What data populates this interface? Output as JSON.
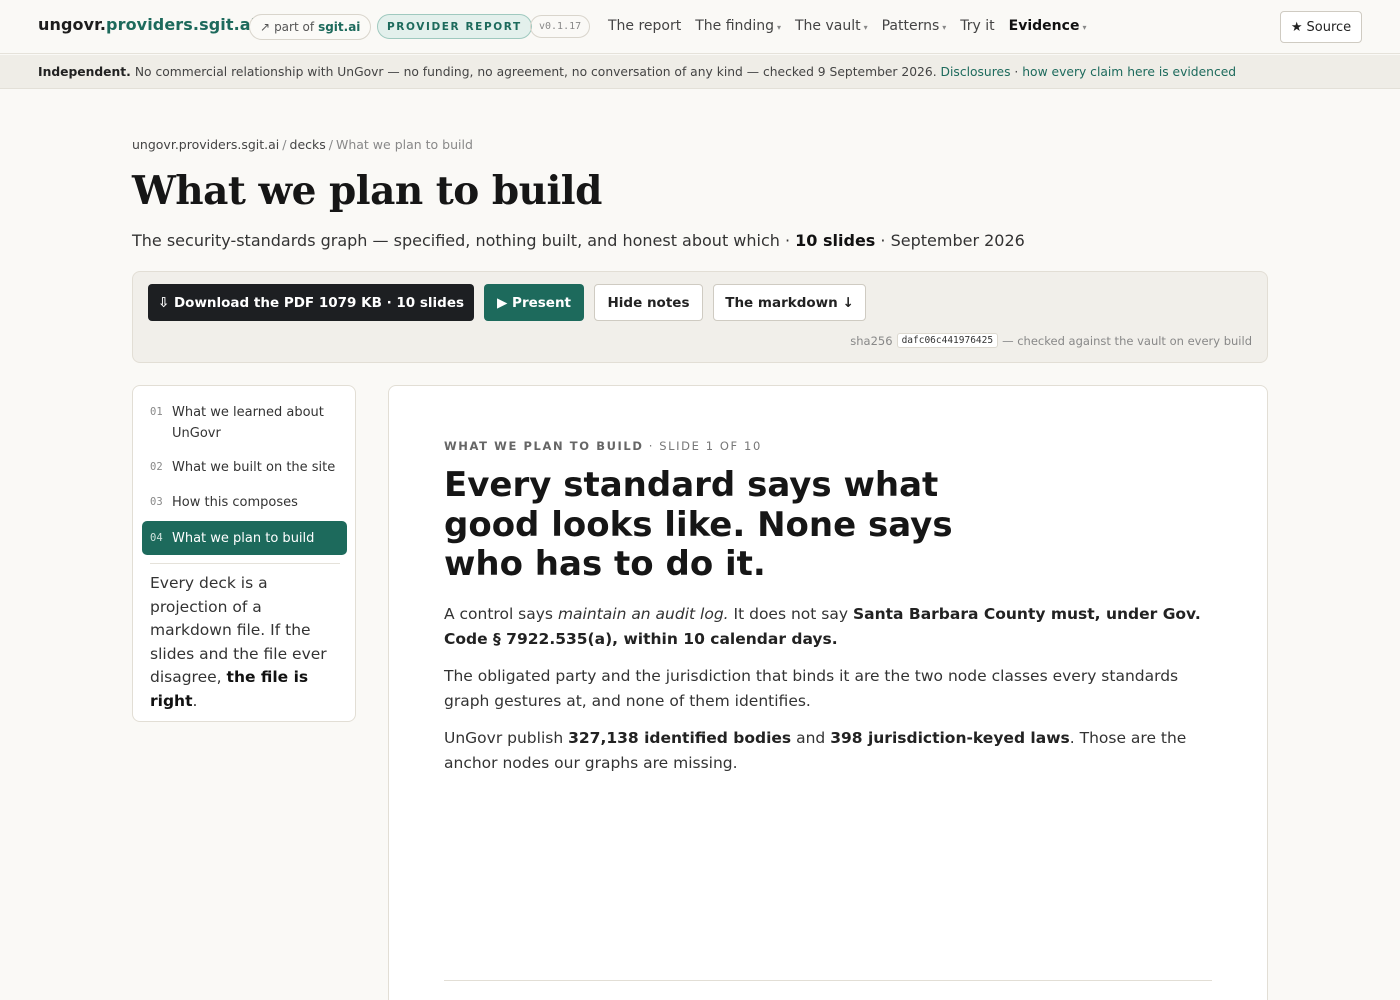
{
  "nav": {
    "brand_prefix": "ungovr.",
    "brand_domain": "providers.sgit.ai",
    "part_of_arrow": "↗",
    "part_of_label": "part of",
    "part_of_link": "sgit.ai",
    "report_badge": "PROVIDER REPORT",
    "version": "v0.1.17",
    "links": [
      {
        "label": "The report",
        "caret": ""
      },
      {
        "label": "The finding",
        "caret": "▾"
      },
      {
        "label": "The vault",
        "caret": "▾"
      },
      {
        "label": "Patterns",
        "caret": "▾"
      },
      {
        "label": "Try it",
        "caret": ""
      },
      {
        "label": "Evidence",
        "caret": "▾"
      }
    ],
    "source_icon": "star-icon",
    "source_star": "★",
    "source_label": "Source"
  },
  "banner": {
    "lead": "Independent.",
    "text": "No commercial relationship with UnGovr — no funding, no agreement, no conversation of any kind — checked 9 September 2026.",
    "link1": "Disclosures",
    "dot": "·",
    "link2": "how every claim here is evidenced"
  },
  "breadcrumb": [
    "ungovr.providers.sgit.ai",
    "decks",
    "What we plan to build"
  ],
  "breadcrumb_sep": "/",
  "page": {
    "title": "What we plan to build",
    "subtitle_text": "The security-standards graph — specified, nothing built, and honest about which ·",
    "subtitle_slides": "10 slides",
    "subtitle_date": "· September 2026"
  },
  "actions": {
    "download": "⇩ Download the PDF 1079 KB · 10 slides",
    "present": "▶ Present",
    "hide_notes": "Hide notes",
    "markdown": "The markdown ↓",
    "sha_label": "sha256",
    "sha_value": "dafc06c441976425",
    "sha_note": "— checked against the vault on every build"
  },
  "sidebar": {
    "items": [
      {
        "num": "01",
        "label": "What we learned about UnGovr"
      },
      {
        "num": "02",
        "label": "What we built on the site"
      },
      {
        "num": "03",
        "label": "How this composes"
      },
      {
        "num": "04",
        "label": "What we plan to build"
      }
    ],
    "note_pre": "Every deck is a projection of a markdown file. If the slides and the file ever disagree,",
    "note_bold": "the file is right",
    "note_post": "."
  },
  "slide": {
    "kicker_section": "WHAT WE PLAN TO BUILD",
    "kicker_count": "· SLIDE 1 OF 10",
    "headline": "Every standard says what good looks like. None says who has to do it.",
    "p1_a": "A control says",
    "p1_em": "maintain an audit log.",
    "p1_b": "It does not say",
    "p1_strong": "Santa Barbara County must, under Gov. Code § 7922.535(a), within 10 calendar days.",
    "p2": "The obligated party and the jurisdiction that binds it are the two node classes every standards graph gestures at, and none of them identifies.",
    "p3_a": "UnGovr publish",
    "p3_b1": "327,138 identified bodies",
    "p3_and": "and",
    "p3_b2": "398 jurisdiction-keyed laws",
    "p3_c": ". Those are the anchor nodes our graphs are missing."
  },
  "colors": {
    "accent": "#1d6a5c",
    "dark_button": "#1d1f22",
    "page_bg": "#faf9f6",
    "banner_bg": "#efede7"
  }
}
